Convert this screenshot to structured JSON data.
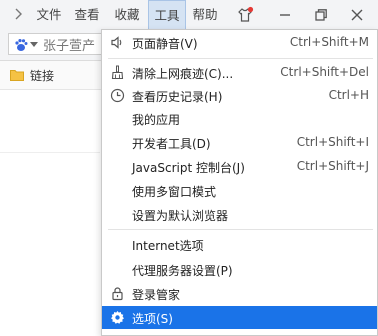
{
  "menubar": {
    "items": [
      {
        "label": "文件"
      },
      {
        "label": "查看"
      },
      {
        "label": "收藏"
      },
      {
        "label": "工具"
      },
      {
        "label": "帮助"
      }
    ]
  },
  "toolbar": {
    "address_text": "张子萱产"
  },
  "bookmarks": {
    "items": [
      {
        "label": "链接"
      }
    ]
  },
  "tools_menu": {
    "items": [
      {
        "label": "页面静音(V)",
        "shortcut": "Ctrl+Shift+M",
        "icon": "speaker-icon"
      },
      {
        "label": "清除上网痕迹(C)...",
        "shortcut": "Ctrl+Shift+Del",
        "icon": "broom-icon"
      },
      {
        "label": "查看历史记录(H)",
        "shortcut": "Ctrl+H",
        "icon": "clock-icon"
      },
      {
        "label": "我的应用",
        "shortcut": ""
      },
      {
        "label": "开发者工具(D)",
        "shortcut": "Ctrl+Shift+I"
      },
      {
        "label": "JavaScript 控制台(J)",
        "shortcut": "Ctrl+Shift+J"
      },
      {
        "label": "使用多窗口模式",
        "shortcut": ""
      },
      {
        "label": "设置为默认浏览器",
        "shortcut": ""
      },
      {
        "label": "Internet选项",
        "shortcut": ""
      },
      {
        "label": "代理服务器设置(P)",
        "shortcut": ""
      },
      {
        "label": "登录管家",
        "shortcut": "",
        "icon": "lock-icon"
      },
      {
        "label": "选项(S)",
        "shortcut": "",
        "icon": "gear-icon",
        "selected": true
      }
    ]
  },
  "colors": {
    "accent": "#1a73e8",
    "active_menu_bg": "#d5e3f3",
    "notification_dot": "#e53935"
  }
}
